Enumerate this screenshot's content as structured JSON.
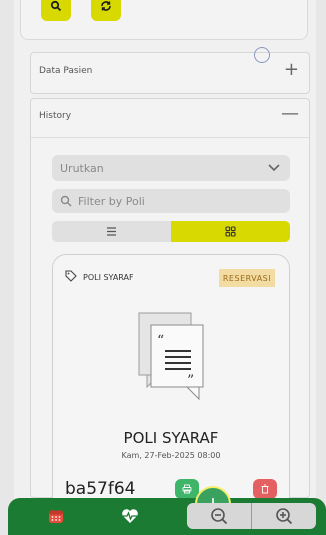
{
  "accordions": {
    "data_pasien": {
      "title": "Data Pasien",
      "toggle": "+"
    },
    "history": {
      "title": "History",
      "toggle": "—"
    }
  },
  "filters": {
    "sort_value": "Urutkan",
    "poli_placeholder": "Filter by Poli"
  },
  "card": {
    "poli_label": "POLI SYARAF",
    "status_badge": "RESERVASI",
    "poli_title": "POLI SYARAF",
    "date": "Kam, 27-Feb-2025 08:00",
    "code": "ba57f64"
  },
  "colors": {
    "accent": "#d8d900",
    "nav_green": "#1c7b32",
    "badge_bg": "#f2dca2",
    "print_green": "#3fb56a",
    "delete_red": "#e56060"
  },
  "icons": {
    "top_buttons": [
      "search-icon",
      "refresh-icon"
    ],
    "view_toggle": [
      "list-icon",
      "grid-icon"
    ],
    "nav": [
      "calendar-icon",
      "heartbeat-icon"
    ],
    "zoom": [
      "zoom-out-icon",
      "zoom-in-icon"
    ]
  }
}
